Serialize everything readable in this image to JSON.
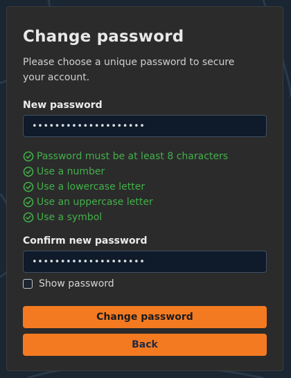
{
  "form": {
    "title": "Change password",
    "subtitle": "Please choose a unique password to secure your account.",
    "new_password_label": "New password",
    "new_password_value": "••••••••••••••••••••",
    "requirements": [
      {
        "text": "Password must be at least 8 characters",
        "met": true
      },
      {
        "text": "Use a number",
        "met": true
      },
      {
        "text": "Use a lowercase letter",
        "met": true
      },
      {
        "text": "Use an uppercase letter",
        "met": true
      },
      {
        "text": "Use a symbol",
        "met": true
      }
    ],
    "confirm_password_label": "Confirm new password",
    "confirm_password_value": "••••••••••••••••••••",
    "show_password_label": "Show password",
    "show_password_checked": false,
    "submit_label": "Change password",
    "back_label": "Back"
  },
  "colors": {
    "accent": "#f37a21",
    "success": "#43b04a",
    "card": "#2b2b2b",
    "input_bg": "#0f1b2a",
    "background": "#1a2733"
  },
  "icons": {
    "requirement": "check-circle-icon"
  }
}
